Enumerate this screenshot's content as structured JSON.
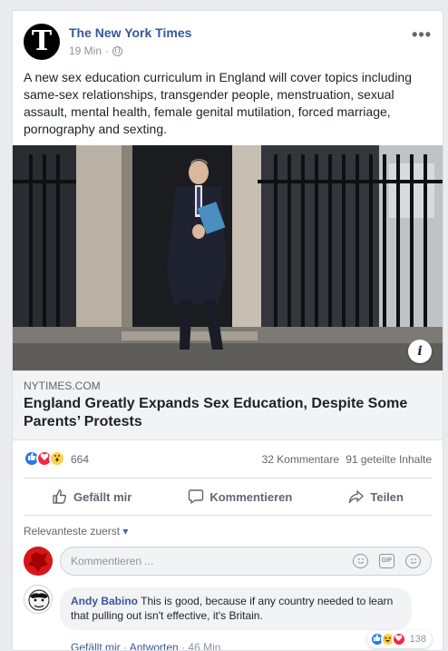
{
  "post": {
    "page_name": "The New York Times",
    "logo_text": "T",
    "timestamp": "19 Min",
    "privacy_icon": "globe-icon",
    "more_icon": "more-options-icon",
    "more_glyph": "•••",
    "text": "A new sex education curriculum in England will cover topics including same-sex relationships, transgender people, menstruation, sexual assault, mental health, female genital mutilation, forced marriage, pornography and sexting."
  },
  "link_preview": {
    "domain": "NYTIMES.COM",
    "title": "England Greatly Expands Sex Education, Despite Some Parents’ Protests",
    "info_glyph": "i"
  },
  "stats": {
    "reaction_types": [
      "like",
      "love",
      "wow"
    ],
    "reaction_count": "664",
    "comments": "32 Kommentare",
    "shares": "91 geteilte Inhalte"
  },
  "actions": {
    "like": "Gefällt mir",
    "comment": "Kommentieren",
    "share": "Teilen"
  },
  "comments_section": {
    "sort_label": "Relevanteste zuerst",
    "sort_arrow": "▾",
    "input_placeholder": "Kommentieren ...",
    "gif_label": "GIF"
  },
  "comment": {
    "author": "Andy Babino",
    "text": "This is good, because if any country needed to learn that pulling out isn't effective, it's Britain.",
    "reaction_count": "138",
    "reaction_types": [
      "like",
      "haha",
      "love"
    ],
    "like_label": "Gefällt mir",
    "reply_label": "Antworten",
    "separator": " · ",
    "time": "46 Min."
  },
  "colors": {
    "link_blue": "#365899",
    "like_blue": "#2078f4",
    "love_red": "#f0284a",
    "wow_yellow": "#fbd24a",
    "background": "#e9ebee"
  }
}
